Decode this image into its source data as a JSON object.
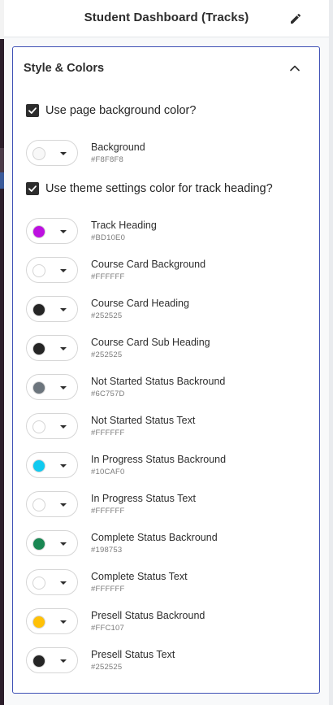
{
  "header": {
    "title": "Student Dashboard (Tracks)"
  },
  "section": {
    "title": "Style & Colors",
    "options": {
      "use_page_bg": {
        "label": "Use page background color?",
        "checked": true
      },
      "use_theme_heading": {
        "label": "Use theme settings color for track heading?",
        "checked": true
      }
    },
    "background": {
      "name": "Background",
      "hex": "#F8F8F8"
    },
    "colors": [
      {
        "name": "Track Heading",
        "hex": "#BD10E0"
      },
      {
        "name": "Course Card Background",
        "hex": "#FFFFFF"
      },
      {
        "name": "Course Card Heading",
        "hex": "#252525"
      },
      {
        "name": "Course Card Sub Heading",
        "hex": "#252525"
      },
      {
        "name": "Not Started Status Backround",
        "hex": "#6C757D"
      },
      {
        "name": "Not Started Status Text",
        "hex": "#FFFFFF"
      },
      {
        "name": "In Progress Status Backround",
        "hex": "#10CAF0"
      },
      {
        "name": "In Progress Status Text",
        "hex": "#FFFFFF"
      },
      {
        "name": "Complete Status Backround",
        "hex": "#198753"
      },
      {
        "name": "Complete Status Text",
        "hex": "#FFFFFF"
      },
      {
        "name": "Presell Status Backround",
        "hex": "#FFC107"
      },
      {
        "name": "Presell Status Text",
        "hex": "#252525"
      }
    ]
  },
  "icons": {
    "edit": "pencil-icon",
    "collapse": "chevron-up-icon",
    "checkbox": "check-icon",
    "dropdown": "caret-down-icon"
  }
}
